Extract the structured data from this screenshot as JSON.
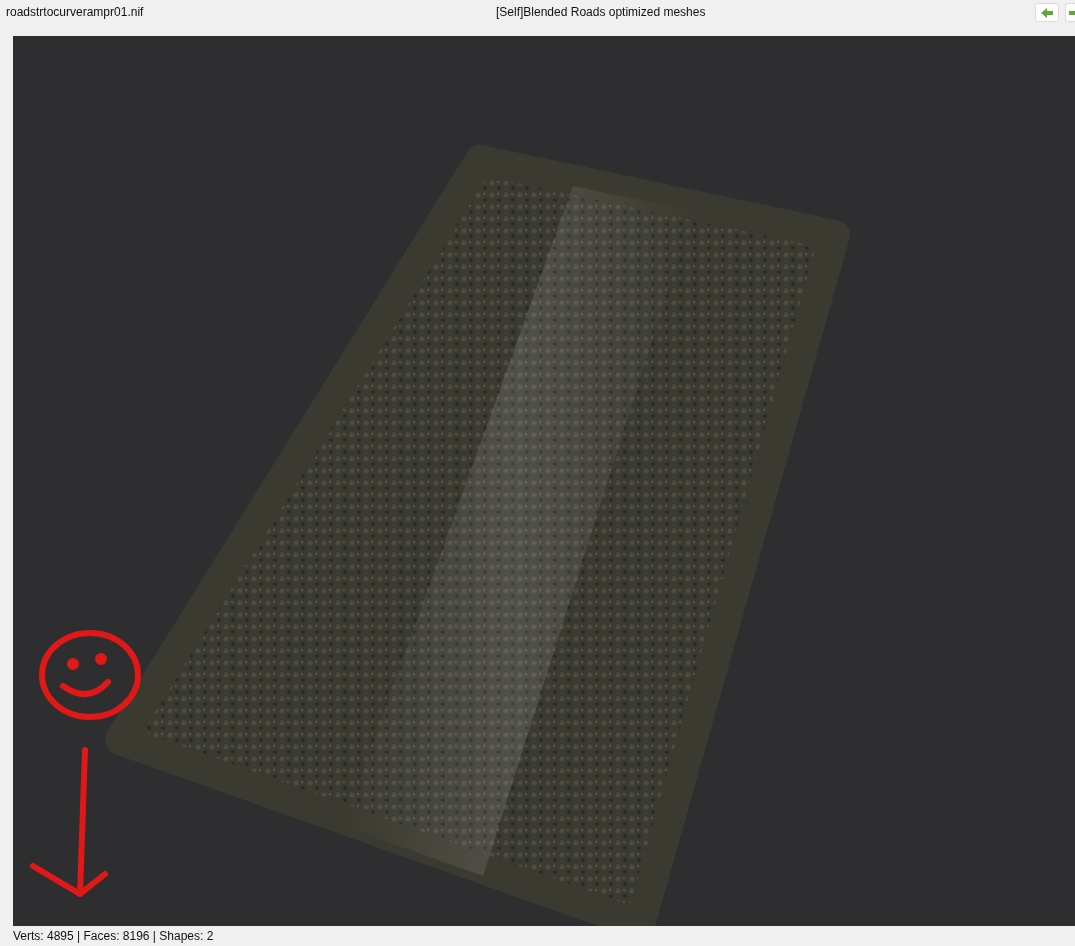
{
  "file_name": "roadstrtocurverampr01.nif",
  "title": "[Self]Blended Roads optimized meshes",
  "status_bar": "Verts: 4895 | Faces: 8196 | Shapes: 2"
}
